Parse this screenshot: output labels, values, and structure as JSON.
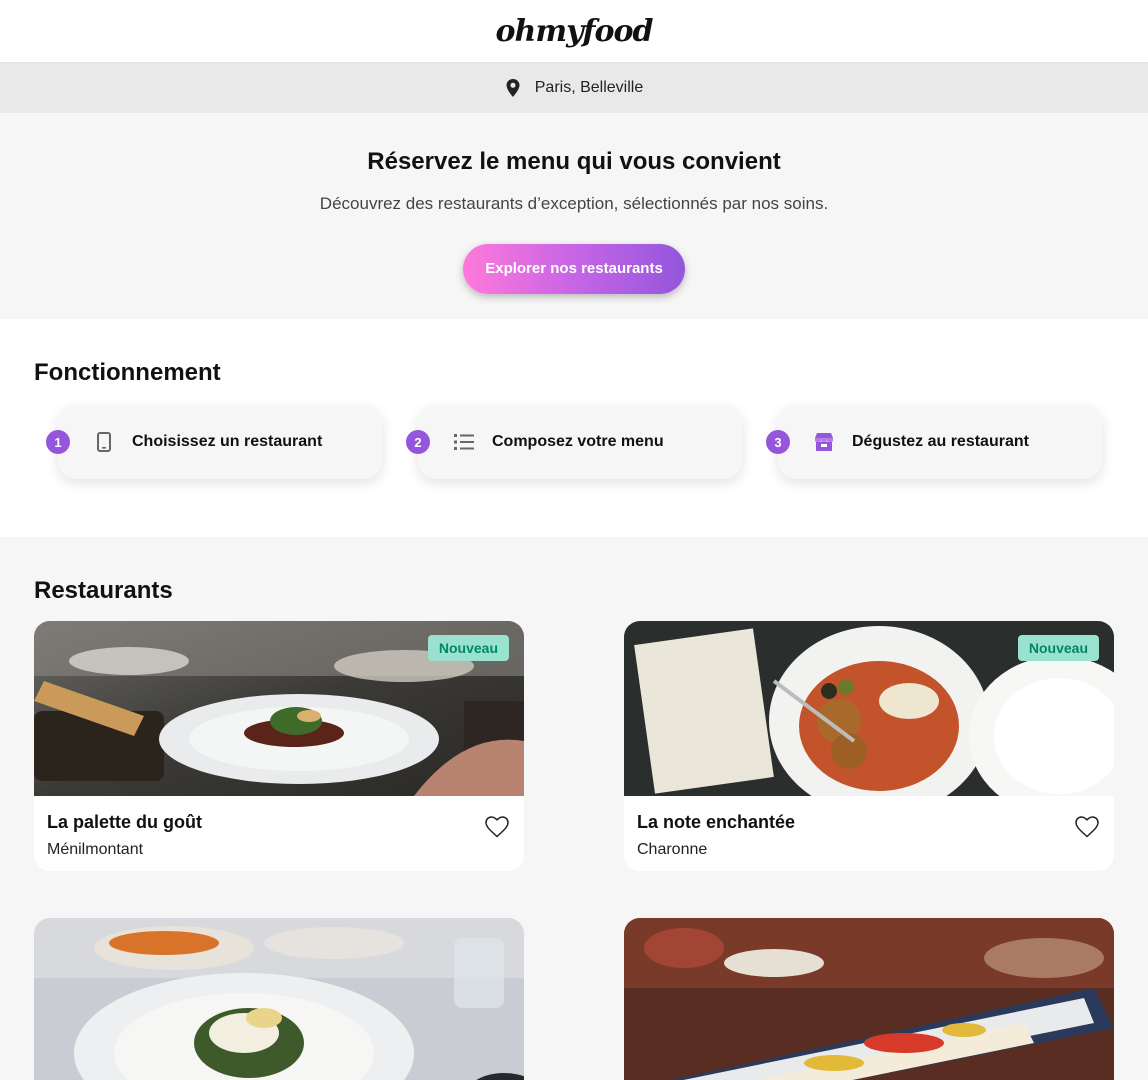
{
  "header": {
    "logo": "ohmyfood"
  },
  "location": {
    "text": "Paris, Belleville",
    "icon": "map-pin-icon"
  },
  "hero": {
    "title": "Réservez le menu qui vous convient",
    "subtitle": "Découvrez des restaurants d’exception, sélectionnés par nos soins.",
    "cta_label": "Explorer nos restaurants"
  },
  "how": {
    "title": "Fonctionnement",
    "steps": [
      {
        "number": "1",
        "label": "Choisissez un restaurant",
        "icon": "mobile-phone-icon"
      },
      {
        "number": "2",
        "label": "Composez votre menu",
        "icon": "list-icon"
      },
      {
        "number": "3",
        "label": "Dégustez au restaurant",
        "icon": "store-icon"
      }
    ]
  },
  "restaurants": {
    "title": "Restaurants",
    "items": [
      {
        "name": "La palette du goût",
        "location": "Ménilmontant",
        "badge": "Nouveau"
      },
      {
        "name": "La note enchantée",
        "location": "Charonne",
        "badge": "Nouveau"
      },
      {
        "name": "",
        "location": "",
        "badge": ""
      },
      {
        "name": "",
        "location": "",
        "badge": ""
      }
    ]
  },
  "colors": {
    "accent": "#9356dc",
    "gradient_start": "#ff79da",
    "badge_bg": "#99e2d0",
    "badge_text": "#008766"
  }
}
